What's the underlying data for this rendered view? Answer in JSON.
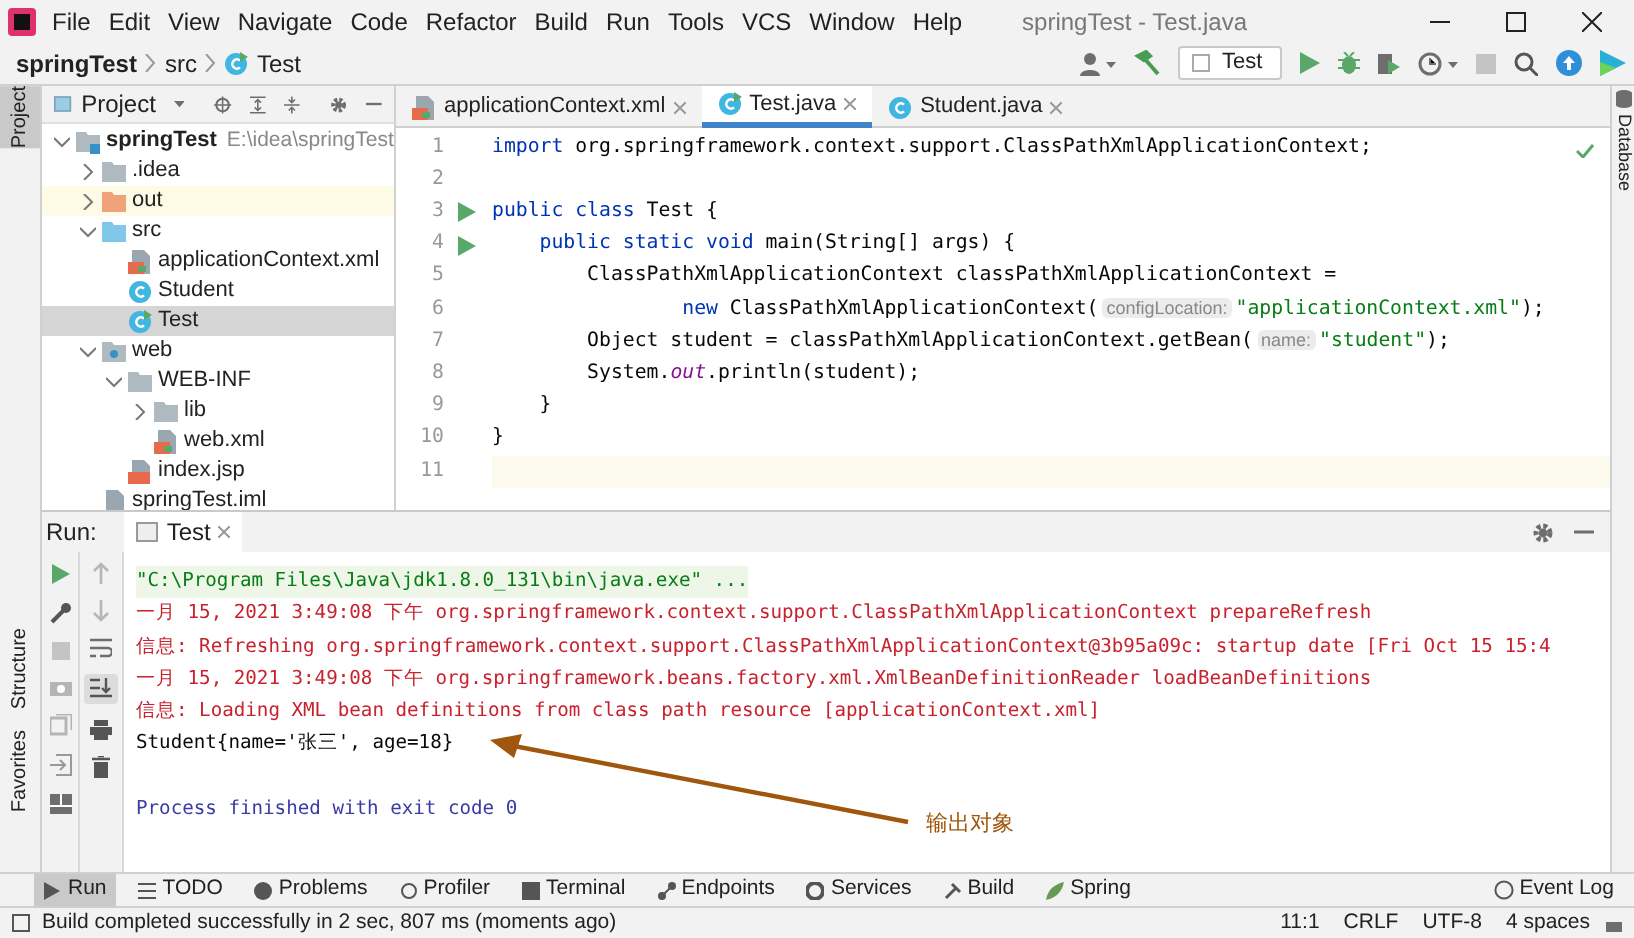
{
  "window": {
    "title": "springTest - Test.java"
  },
  "menu": [
    "File",
    "Edit",
    "View",
    "Navigate",
    "Code",
    "Refactor",
    "Build",
    "Run",
    "Tools",
    "VCS",
    "Window",
    "Help"
  ],
  "breadcrumb": [
    "springTest",
    "src",
    "Test"
  ],
  "run_config": "Test",
  "left_stripe": [
    {
      "label": "Project",
      "selected": true
    },
    {
      "label": "Structure",
      "selected": false
    },
    {
      "label": "Favorites",
      "selected": false
    }
  ],
  "right_stripe": [
    "Database"
  ],
  "project_panel": {
    "title": "Project",
    "tree": [
      {
        "label": "springTest",
        "kind": "module",
        "path": "E:\\idea\\springTest",
        "expanded": true,
        "selected": false,
        "children": [
          {
            "label": ".idea",
            "kind": "folder",
            "expanded": false,
            "selected": false
          },
          {
            "label": "out",
            "kind": "excluded-folder",
            "expanded": false,
            "selected": false
          },
          {
            "label": "src",
            "kind": "source-folder",
            "expanded": true,
            "selected": false,
            "children": [
              {
                "label": "applicationContext.xml",
                "kind": "xml",
                "selected": false
              },
              {
                "label": "Student",
                "kind": "class",
                "selected": false
              },
              {
                "label": "Test",
                "kind": "main-class",
                "selected": true
              }
            ]
          },
          {
            "label": "web",
            "kind": "web-folder",
            "expanded": true,
            "selected": false,
            "children": [
              {
                "label": "WEB-INF",
                "kind": "folder",
                "expanded": true,
                "selected": false,
                "children": [
                  {
                    "label": "lib",
                    "kind": "folder",
                    "expanded": false,
                    "selected": false
                  },
                  {
                    "label": "web.xml",
                    "kind": "xml",
                    "selected": false
                  }
                ]
              },
              {
                "label": "index.jsp",
                "kind": "jsp",
                "selected": false
              }
            ]
          },
          {
            "label": "springTest.iml",
            "kind": "iml",
            "selected": false
          }
        ]
      }
    ]
  },
  "editor_tabs": [
    {
      "label": "applicationContext.xml",
      "kind": "xml",
      "selected": false
    },
    {
      "label": "Test.java",
      "kind": "main-class",
      "selected": true
    },
    {
      "label": "Student.java",
      "kind": "class",
      "selected": false
    }
  ],
  "code": [
    {
      "number": "1",
      "run": false,
      "current": false,
      "tokens": [
        {
          "kind": "keyword",
          "text": "import"
        },
        {
          "kind": "plain",
          "text": " org.springframework.context.support.ClassPathXmlApplicationContext;"
        }
      ]
    },
    {
      "number": "2",
      "run": false,
      "current": false
    },
    {
      "number": "3",
      "run": true,
      "current": false,
      "tokens": [
        {
          "kind": "keyword",
          "text": "public class"
        },
        {
          "kind": "plain",
          "text": " Test {"
        }
      ]
    },
    {
      "number": "4",
      "run": true,
      "current": false,
      "tokens": [
        {
          "kind": "keyword",
          "text": "    public static void"
        },
        {
          "kind": "plain",
          "text": " main(String[] args) {"
        }
      ]
    },
    {
      "number": "5",
      "run": false,
      "current": false,
      "tokens": [
        {
          "kind": "plain",
          "text": "        ClassPathXmlApplicationContext classPathXmlApplicationContext ="
        }
      ]
    },
    {
      "number": "6",
      "run": false,
      "current": false,
      "tokens": [
        {
          "kind": "keyword",
          "text": "                new"
        },
        {
          "kind": "plain",
          "text": " ClassPathXmlApplicationContext("
        },
        {
          "kind": "hint",
          "text": "configLocation:"
        },
        {
          "kind": "string",
          "text": "\"applicationContext.xml\""
        },
        {
          "kind": "plain",
          "text": ");"
        }
      ]
    },
    {
      "number": "7",
      "run": false,
      "current": false,
      "tokens": [
        {
          "kind": "plain",
          "text": "        Object student = classPathXmlApplicationContext.getBean("
        },
        {
          "kind": "hint",
          "text": "name:"
        },
        {
          "kind": "string",
          "text": "\"student\""
        },
        {
          "kind": "plain",
          "text": ");"
        }
      ]
    },
    {
      "number": "8",
      "run": false,
      "current": false,
      "tokens": [
        {
          "kind": "plain",
          "text": "        System."
        },
        {
          "kind": "field",
          "text": "out"
        },
        {
          "kind": "plain",
          "text": ".println(student);"
        }
      ]
    },
    {
      "number": "9",
      "run": false,
      "current": false,
      "tokens": [
        {
          "kind": "plain",
          "text": "    }"
        }
      ]
    },
    {
      "number": "10",
      "run": false,
      "current": false,
      "tokens": [
        {
          "kind": "plain",
          "text": "}"
        }
      ]
    },
    {
      "number": "11",
      "run": false,
      "current": true
    }
  ],
  "run_panel": {
    "title": "Run:",
    "tabs": [
      {
        "label": "Test",
        "selected": true
      }
    ],
    "console": [
      {
        "kind": "command",
        "text": "\"C:\\Program Files\\Java\\jdk1.8.0_131\\bin\\java.exe\" ..."
      },
      {
        "kind": "stderr",
        "text": "一月 15, 2021 3:49:08 下午 org.springframework.context.support.ClassPathXmlApplicationContext prepareRefresh"
      },
      {
        "kind": "stderr",
        "text": "信息: Refreshing org.springframework.context.support.ClassPathXmlApplicationContext@3b95a09c: startup date [Fri Oct 15 15:4"
      },
      {
        "kind": "stderr",
        "text": "一月 15, 2021 3:49:08 下午 org.springframework.beans.factory.xml.XmlBeanDefinitionReader loadBeanDefinitions"
      },
      {
        "kind": "stderr",
        "text": "信息: Loading XML bean definitions from class path resource [applicationContext.xml]"
      },
      {
        "kind": "stdout",
        "text": "Student{name='张三', age=18}"
      },
      {
        "kind": "exit",
        "text": "Process finished with exit code 0"
      }
    ],
    "annotation": "输出对象"
  },
  "tool_tabs": [
    {
      "label": "Run",
      "selected": true
    },
    {
      "label": "TODO",
      "selected": false
    },
    {
      "label": "Problems",
      "selected": false
    },
    {
      "label": "Profiler",
      "selected": false
    },
    {
      "label": "Terminal",
      "selected": false
    },
    {
      "label": "Endpoints",
      "selected": false
    },
    {
      "label": "Services",
      "selected": false
    },
    {
      "label": "Build",
      "selected": false
    },
    {
      "label": "Spring",
      "selected": false
    }
  ],
  "event_log": "Event Log",
  "status_bar": {
    "message": "Build completed successfully in 2 sec, 807 ms (moments ago)",
    "items": [
      "11:1",
      "CRLF",
      "UTF-8",
      "4 spaces"
    ]
  }
}
